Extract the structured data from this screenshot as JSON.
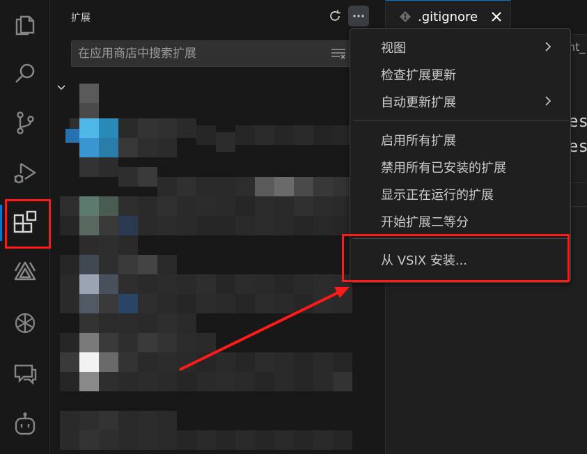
{
  "sidebar": {
    "title": "扩展",
    "search": {
      "placeholder": "在应用商店中搜索扩展",
      "value": ""
    }
  },
  "activity_bar": {
    "items": [
      {
        "name": "explorer-icon"
      },
      {
        "name": "search-icon"
      },
      {
        "name": "source-control-icon"
      },
      {
        "name": "run-debug-icon"
      },
      {
        "name": "extensions-icon",
        "active": true
      },
      {
        "name": "tongyi-lingma-icon"
      },
      {
        "name": "chatgpt-icon"
      },
      {
        "name": "comments-icon"
      },
      {
        "name": "copilot-icon"
      }
    ]
  },
  "tab": {
    "label": ".gitignore",
    "close": "✕"
  },
  "editor": {
    "breadcrumb": "nt_",
    "code_lines": [
      "es",
      "est"
    ]
  },
  "menu": {
    "items": [
      {
        "label": "视图",
        "submenu": true
      },
      {
        "label": "检查扩展更新",
        "submenu": false
      },
      {
        "label": "自动更新扩展",
        "submenu": true
      },
      {
        "label": "启用所有扩展",
        "submenu": false
      },
      {
        "label": "禁用所有已安装的扩展",
        "submenu": false
      },
      {
        "label": "显示正在运行的扩展",
        "submenu": false
      },
      {
        "label": "开始扩展二等分",
        "submenu": false
      },
      {
        "label": "从 VSIX 安装...",
        "submenu": false
      }
    ]
  },
  "colors": {
    "accent": "#0078d4",
    "annotation": "#ff1a1a",
    "background": "#1f1f1f",
    "sidebar_background": "#181818"
  }
}
